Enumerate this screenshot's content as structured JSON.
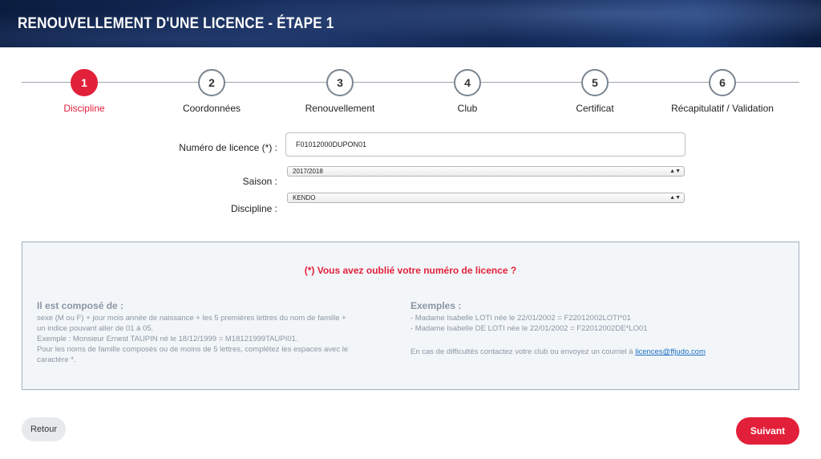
{
  "header": {
    "title": "RENOUVELLEMENT D'UNE LICENCE - ÉTAPE 1"
  },
  "steps": [
    {
      "number": "1",
      "label": "Discipline",
      "active": true
    },
    {
      "number": "2",
      "label": "Coordonnées",
      "active": false
    },
    {
      "number": "3",
      "label": "Renouvellement",
      "active": false
    },
    {
      "number": "4",
      "label": "Club",
      "active": false
    },
    {
      "number": "5",
      "label": "Certificat",
      "active": false
    },
    {
      "number": "6",
      "label": "Récapitulatif / Validation",
      "active": false
    }
  ],
  "form": {
    "licence_label": "Numéro de licence (*) :",
    "licence_value": "F01012000DUPON01",
    "saison_label": "Saison :",
    "saison_value": "2017/2018",
    "discipline_label": "Discipline :",
    "discipline_value": "KENDO"
  },
  "info": {
    "title": "(*) Vous avez oublié votre numéro de licence ?",
    "left_title": "Il est composé de :",
    "left_lines": [
      "sexe (M ou F) + jour mois année de naissance + les 5 premières lettres du nom de famille +",
      "un indice pouvant aller de 01 à 05.",
      "Exemple : Monsieur Ernest TAUPIN né le 18/12/1999 = M18121999TAUPI01.",
      "Pour les noms de famille composés ou de moins de 5 lettres, complétez les espaces avec le",
      "caractère *."
    ],
    "right_title": "Exemples :",
    "right_lines": [
      "- Madame Isabelle LOTI née le 22/01/2002 = F22012002LOTI*01",
      "- Madame Isabelle DE LOTI née le 22/01/2002 = F22012002DE*LO01"
    ],
    "contact_text": "En cas de difficultés contactez votre club ou envoyez un courriel à ",
    "contact_email": "licences@ffjudo.com"
  },
  "buttons": {
    "back": "Retour",
    "next": "Suivant"
  },
  "colors": {
    "accent": "#e3203a",
    "header_bg": "#0f2550"
  }
}
